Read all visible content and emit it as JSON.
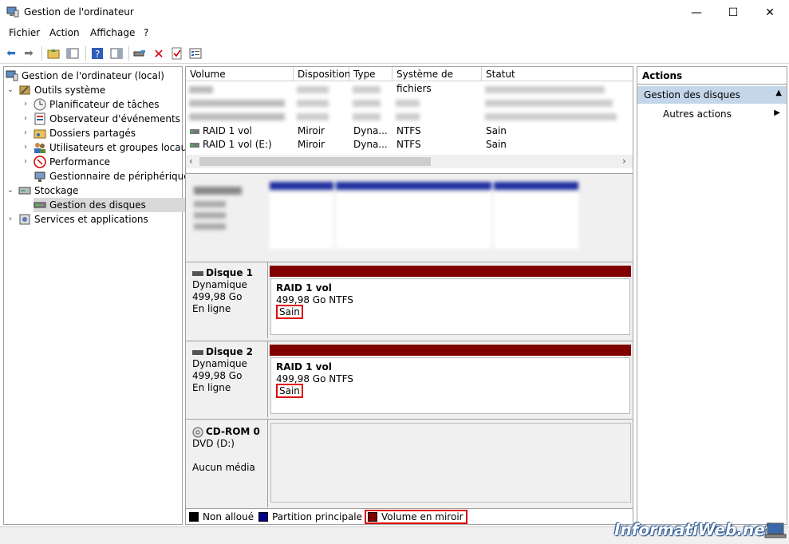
{
  "window": {
    "title": "Gestion de l'ordinateur",
    "minimize": "—",
    "maximize": "☐",
    "close": "✕"
  },
  "menu": [
    "Fichier",
    "Action",
    "Affichage",
    "?"
  ],
  "tree": {
    "root": "Gestion de l'ordinateur (local)",
    "tools": "Outils système",
    "tools_items": [
      "Planificateur de tâches",
      "Observateur d'événements",
      "Dossiers partagés",
      "Utilisateurs et groupes locaux",
      "Performance",
      "Gestionnaire de périphériques"
    ],
    "storage": "Stockage",
    "disk_mgmt": "Gestion des disques",
    "services": "Services et applications"
  },
  "volumes": {
    "columns": [
      "Volume",
      "Disposition",
      "Type",
      "Système de fichiers",
      "Statut"
    ],
    "rows": [
      {
        "volume": "RAID 1 vol",
        "layout": "Miroir",
        "type": "Dyna...",
        "fs": "NTFS",
        "status": "Sain"
      },
      {
        "volume": "RAID 1 vol (E:)",
        "layout": "Miroir",
        "type": "Dyna...",
        "fs": "NTFS",
        "status": "Sain"
      }
    ]
  },
  "disks": [
    {
      "name": "Disque 1",
      "type": "Dynamique",
      "size": "499,98 Go",
      "state": "En ligne",
      "vol_name": "RAID 1 vol",
      "vol_size": "499,98 Go NTFS",
      "vol_status": "Sain"
    },
    {
      "name": "Disque 2",
      "type": "Dynamique",
      "size": "499,98 Go",
      "state": "En ligne",
      "vol_name": "RAID 1 vol",
      "vol_size": "499,98 Go NTFS",
      "vol_status": "Sain"
    }
  ],
  "cdrom": {
    "name": "CD-ROM 0",
    "type": "DVD (D:)",
    "media": "Aucun média"
  },
  "legend": {
    "unallocated": "Non alloué",
    "primary": "Partition principale",
    "mirror": "Volume en miroir"
  },
  "actions": {
    "header": "Actions",
    "section": "Gestion des disques",
    "more": "Autres actions"
  },
  "watermark": "InformatiWeb.net",
  "colors": {
    "mirror": "#800000",
    "primary": "#00008b",
    "selection": "#d9d9d9",
    "action_header": "#c4d6ea"
  }
}
